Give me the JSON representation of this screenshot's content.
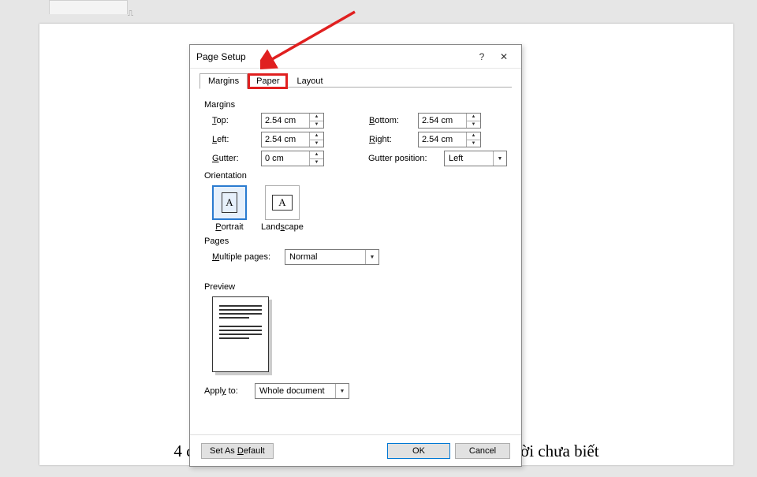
{
  "dialog": {
    "title": "Page Setup",
    "tabs": {
      "margins": "Margins",
      "paper": "Paper",
      "layout": "Layout"
    },
    "margins": {
      "section": "Margins",
      "top_label": "Top:",
      "top_value": "2.54 cm",
      "bottom_label": "Bottom:",
      "bottom_value": "2.54 cm",
      "left_label": "Left:",
      "left_value": "2.54 cm",
      "right_label": "Right:",
      "right_value": "2.54 cm",
      "gutter_label": "Gutter:",
      "gutter_value": "0 cm",
      "gutter_pos_label": "Gutter position:",
      "gutter_pos_value": "Left"
    },
    "orientation": {
      "section": "Orientation",
      "portrait": "Portrait",
      "landscape": "Landscape",
      "glyph": "A"
    },
    "pages": {
      "section": "Pages",
      "multiple_label": "Multiple pages:",
      "multiple_value": "Normal"
    },
    "preview": {
      "section": "Preview"
    },
    "apply": {
      "label": "Apply to:",
      "value": "Whole document"
    },
    "footer": {
      "set_default": "Set As Default",
      "ok": "OK",
      "cancel": "Cancel"
    },
    "help": "?",
    "close": "✕"
  },
  "caption": "4 cách hiện thanh công cụ trong Word mà nhiều người chưa biết"
}
